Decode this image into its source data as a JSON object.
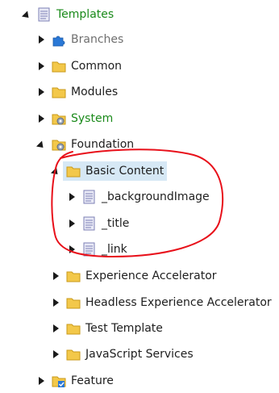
{
  "tree": {
    "templates": "Templates",
    "branches": "Branches",
    "common": "Common",
    "modules": "Modules",
    "system": "System",
    "foundation": "Foundation",
    "basic_content": "Basic Content",
    "background_image": "_backgroundImage",
    "title": "_title",
    "link": "_link",
    "experience_accelerator": "Experience Accelerator",
    "headless_experience_accelerator": "Headless Experience Accelerator",
    "test_template": "Test Template",
    "javascript_services": "JavaScript Services",
    "feature": "Feature"
  },
  "colors": {
    "green_text": "#1a8a1a",
    "gray_text": "#6f6f6f",
    "selection_bg": "#d6e8f5",
    "annotation_red": "#e8101a",
    "folder_yellow": "#f3c84a"
  }
}
